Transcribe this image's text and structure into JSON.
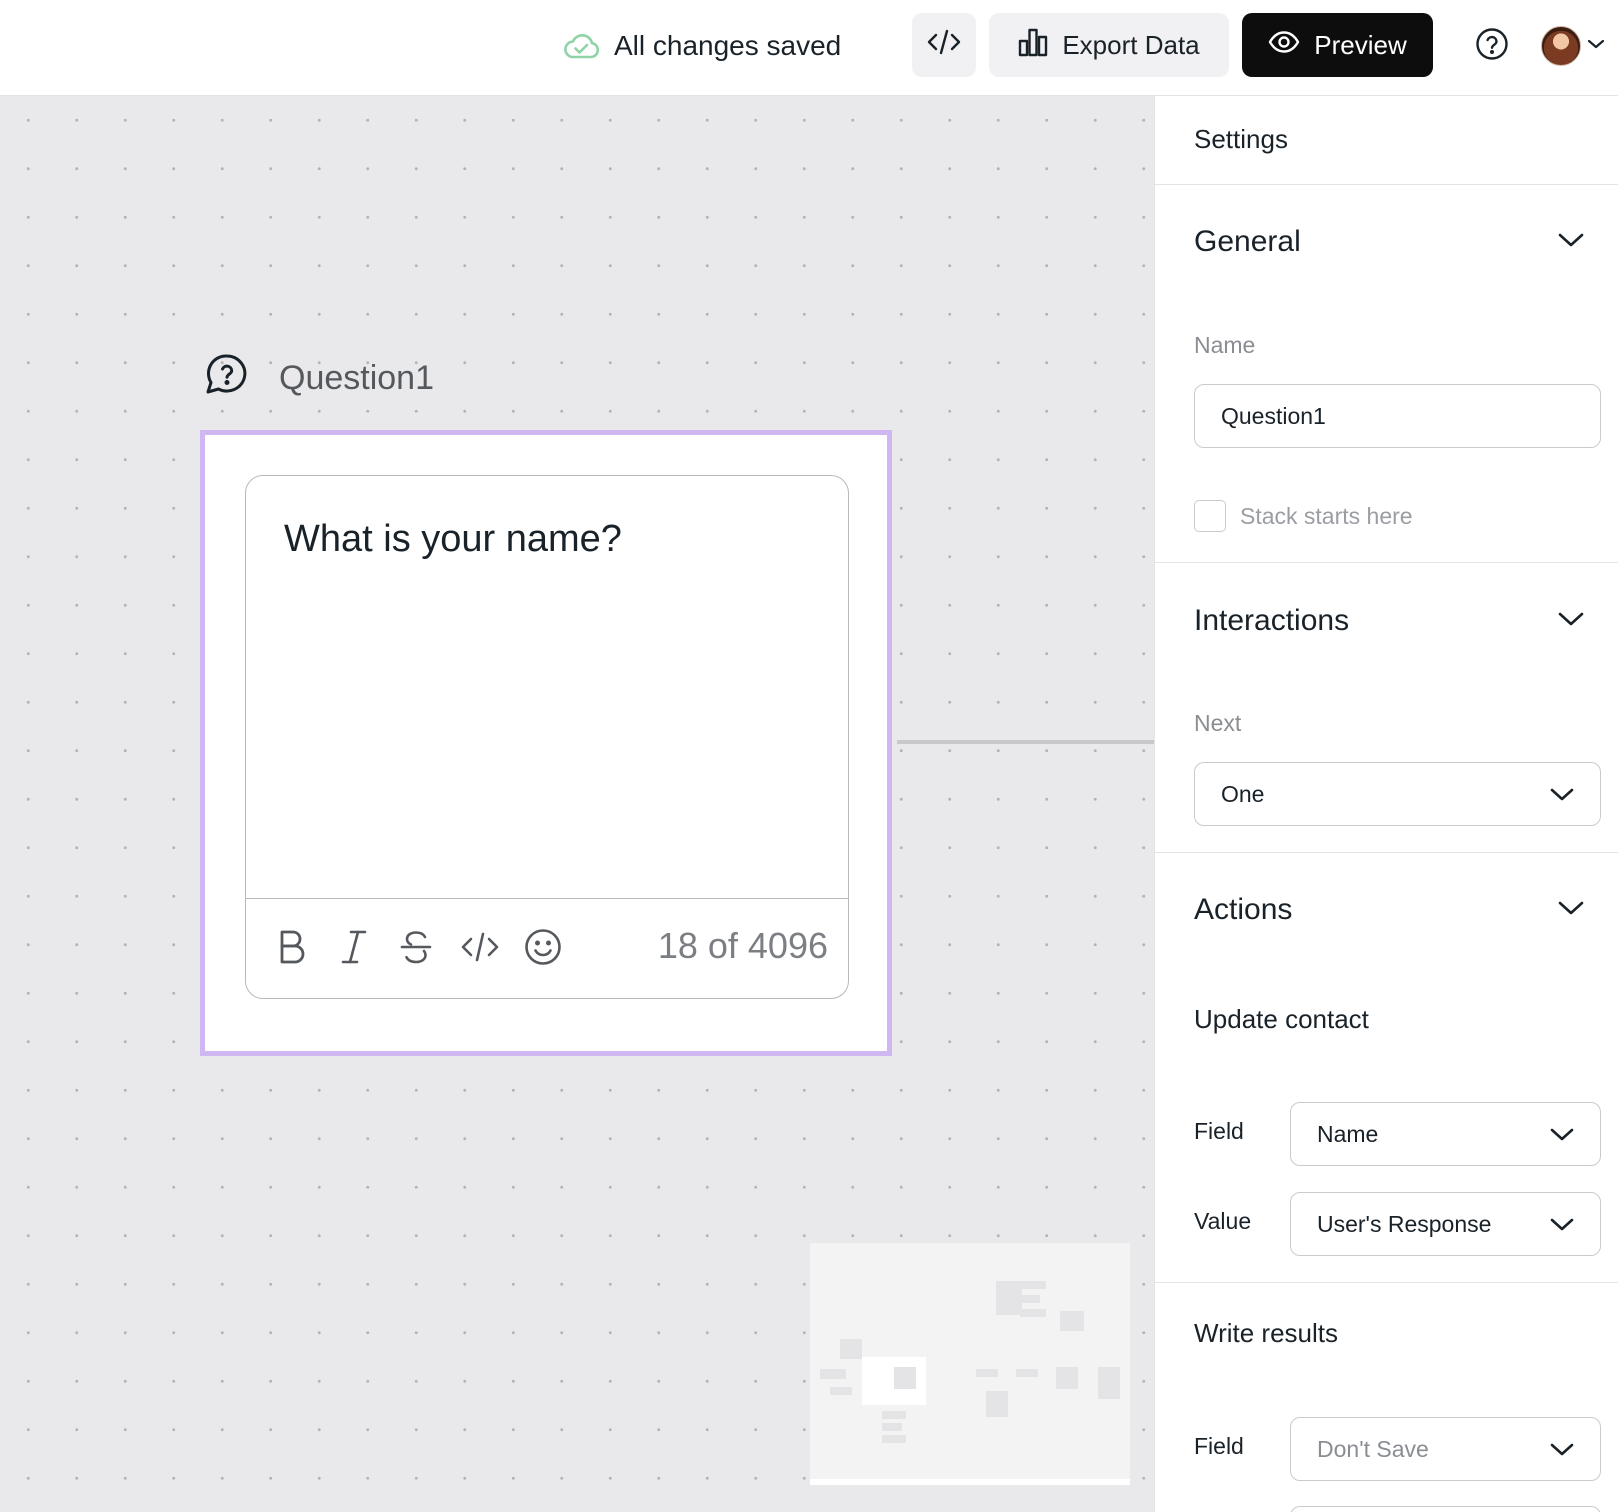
{
  "topbar": {
    "save_status": "All changes saved",
    "code_icon": "code-icon",
    "export_label": "Export Data",
    "preview_label": "Preview",
    "help_icon": "help-icon"
  },
  "canvas": {
    "node_title": "Question1",
    "node_icon": "question-bubble-icon",
    "message_text": "What is your name?",
    "char_count": "18 of 4096",
    "format_tools": [
      "bold-icon",
      "italic-icon",
      "strikethrough-icon",
      "code-icon",
      "emoji-icon"
    ]
  },
  "settings": {
    "title": "Settings",
    "general": {
      "title": "General",
      "name_label": "Name",
      "name_value": "Question1",
      "stack_label": "Stack starts here"
    },
    "interactions": {
      "title": "Interactions",
      "next_label": "Next",
      "next_value": "One"
    },
    "actions": {
      "title": "Actions",
      "update_contact": {
        "title": "Update contact",
        "field_label": "Field",
        "field_value": "Name",
        "value_label": "Value",
        "value_value": "User's Response"
      },
      "write_results": {
        "title": "Write results",
        "field_label": "Field",
        "field_value": "Don't Save"
      }
    }
  },
  "colors": {
    "accent_selection": "#cfb7f2",
    "saved_cloud": "#8fd3a6",
    "preview_bg": "#0d0d0d"
  }
}
